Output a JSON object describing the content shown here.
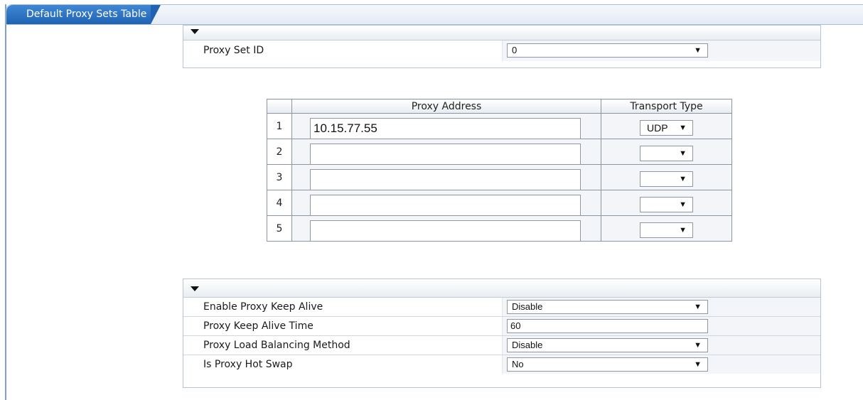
{
  "page": {
    "title": "Default Proxy Sets Table"
  },
  "general_section": {
    "rows": [
      {
        "label": "Proxy Set ID",
        "value": "0",
        "type": "select"
      }
    ]
  },
  "proxy_table": {
    "headers": {
      "index": "",
      "address": "Proxy Address",
      "transport": "Transport Type"
    },
    "rows": [
      {
        "index": "1",
        "address": "10.15.77.55",
        "transport": "UDP"
      },
      {
        "index": "2",
        "address": "",
        "transport": ""
      },
      {
        "index": "3",
        "address": "",
        "transport": ""
      },
      {
        "index": "4",
        "address": "",
        "transport": ""
      },
      {
        "index": "5",
        "address": "",
        "transport": ""
      }
    ]
  },
  "keepalive_section": {
    "rows": [
      {
        "label": "Enable Proxy Keep Alive",
        "value": "Disable",
        "type": "select"
      },
      {
        "label": "Proxy Keep Alive Time",
        "value": "60",
        "type": "text"
      },
      {
        "label": "Proxy Load Balancing Method",
        "value": "Disable",
        "type": "select"
      },
      {
        "label": "Is Proxy Hot Swap",
        "value": "No",
        "type": "select"
      }
    ]
  },
  "icons": {
    "collapse": "triangle-down-icon",
    "dropdown": "chevron-down-icon"
  },
  "colors": {
    "tab_blue": "#2063b3",
    "border": "#b9c4d0",
    "value_bg": "#f3f5f9"
  }
}
